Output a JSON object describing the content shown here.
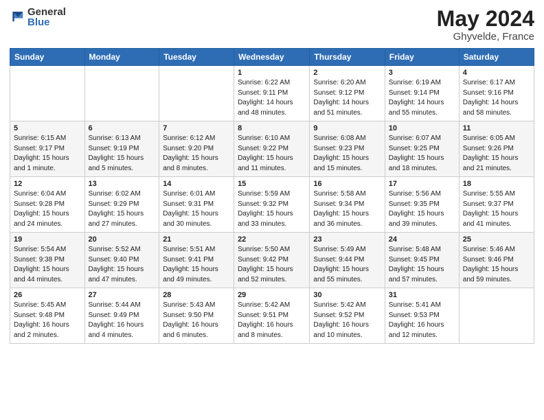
{
  "header": {
    "logo_general": "General",
    "logo_blue": "Blue",
    "title": "May 2024",
    "location": "Ghyvelde, France"
  },
  "weekdays": [
    "Sunday",
    "Monday",
    "Tuesday",
    "Wednesday",
    "Thursday",
    "Friday",
    "Saturday"
  ],
  "weeks": [
    [
      {
        "day": "",
        "detail": ""
      },
      {
        "day": "",
        "detail": ""
      },
      {
        "day": "",
        "detail": ""
      },
      {
        "day": "1",
        "detail": "Sunrise: 6:22 AM\nSunset: 9:11 PM\nDaylight: 14 hours\nand 48 minutes."
      },
      {
        "day": "2",
        "detail": "Sunrise: 6:20 AM\nSunset: 9:12 PM\nDaylight: 14 hours\nand 51 minutes."
      },
      {
        "day": "3",
        "detail": "Sunrise: 6:19 AM\nSunset: 9:14 PM\nDaylight: 14 hours\nand 55 minutes."
      },
      {
        "day": "4",
        "detail": "Sunrise: 6:17 AM\nSunset: 9:16 PM\nDaylight: 14 hours\nand 58 minutes."
      }
    ],
    [
      {
        "day": "5",
        "detail": "Sunrise: 6:15 AM\nSunset: 9:17 PM\nDaylight: 15 hours\nand 1 minute."
      },
      {
        "day": "6",
        "detail": "Sunrise: 6:13 AM\nSunset: 9:19 PM\nDaylight: 15 hours\nand 5 minutes."
      },
      {
        "day": "7",
        "detail": "Sunrise: 6:12 AM\nSunset: 9:20 PM\nDaylight: 15 hours\nand 8 minutes."
      },
      {
        "day": "8",
        "detail": "Sunrise: 6:10 AM\nSunset: 9:22 PM\nDaylight: 15 hours\nand 11 minutes."
      },
      {
        "day": "9",
        "detail": "Sunrise: 6:08 AM\nSunset: 9:23 PM\nDaylight: 15 hours\nand 15 minutes."
      },
      {
        "day": "10",
        "detail": "Sunrise: 6:07 AM\nSunset: 9:25 PM\nDaylight: 15 hours\nand 18 minutes."
      },
      {
        "day": "11",
        "detail": "Sunrise: 6:05 AM\nSunset: 9:26 PM\nDaylight: 15 hours\nand 21 minutes."
      }
    ],
    [
      {
        "day": "12",
        "detail": "Sunrise: 6:04 AM\nSunset: 9:28 PM\nDaylight: 15 hours\nand 24 minutes."
      },
      {
        "day": "13",
        "detail": "Sunrise: 6:02 AM\nSunset: 9:29 PM\nDaylight: 15 hours\nand 27 minutes."
      },
      {
        "day": "14",
        "detail": "Sunrise: 6:01 AM\nSunset: 9:31 PM\nDaylight: 15 hours\nand 30 minutes."
      },
      {
        "day": "15",
        "detail": "Sunrise: 5:59 AM\nSunset: 9:32 PM\nDaylight: 15 hours\nand 33 minutes."
      },
      {
        "day": "16",
        "detail": "Sunrise: 5:58 AM\nSunset: 9:34 PM\nDaylight: 15 hours\nand 36 minutes."
      },
      {
        "day": "17",
        "detail": "Sunrise: 5:56 AM\nSunset: 9:35 PM\nDaylight: 15 hours\nand 39 minutes."
      },
      {
        "day": "18",
        "detail": "Sunrise: 5:55 AM\nSunset: 9:37 PM\nDaylight: 15 hours\nand 41 minutes."
      }
    ],
    [
      {
        "day": "19",
        "detail": "Sunrise: 5:54 AM\nSunset: 9:38 PM\nDaylight: 15 hours\nand 44 minutes."
      },
      {
        "day": "20",
        "detail": "Sunrise: 5:52 AM\nSunset: 9:40 PM\nDaylight: 15 hours\nand 47 minutes."
      },
      {
        "day": "21",
        "detail": "Sunrise: 5:51 AM\nSunset: 9:41 PM\nDaylight: 15 hours\nand 49 minutes."
      },
      {
        "day": "22",
        "detail": "Sunrise: 5:50 AM\nSunset: 9:42 PM\nDaylight: 15 hours\nand 52 minutes."
      },
      {
        "day": "23",
        "detail": "Sunrise: 5:49 AM\nSunset: 9:44 PM\nDaylight: 15 hours\nand 55 minutes."
      },
      {
        "day": "24",
        "detail": "Sunrise: 5:48 AM\nSunset: 9:45 PM\nDaylight: 15 hours\nand 57 minutes."
      },
      {
        "day": "25",
        "detail": "Sunrise: 5:46 AM\nSunset: 9:46 PM\nDaylight: 15 hours\nand 59 minutes."
      }
    ],
    [
      {
        "day": "26",
        "detail": "Sunrise: 5:45 AM\nSunset: 9:48 PM\nDaylight: 16 hours\nand 2 minutes."
      },
      {
        "day": "27",
        "detail": "Sunrise: 5:44 AM\nSunset: 9:49 PM\nDaylight: 16 hours\nand 4 minutes."
      },
      {
        "day": "28",
        "detail": "Sunrise: 5:43 AM\nSunset: 9:50 PM\nDaylight: 16 hours\nand 6 minutes."
      },
      {
        "day": "29",
        "detail": "Sunrise: 5:42 AM\nSunset: 9:51 PM\nDaylight: 16 hours\nand 8 minutes."
      },
      {
        "day": "30",
        "detail": "Sunrise: 5:42 AM\nSunset: 9:52 PM\nDaylight: 16 hours\nand 10 minutes."
      },
      {
        "day": "31",
        "detail": "Sunrise: 5:41 AM\nSunset: 9:53 PM\nDaylight: 16 hours\nand 12 minutes."
      },
      {
        "day": "",
        "detail": ""
      }
    ]
  ]
}
